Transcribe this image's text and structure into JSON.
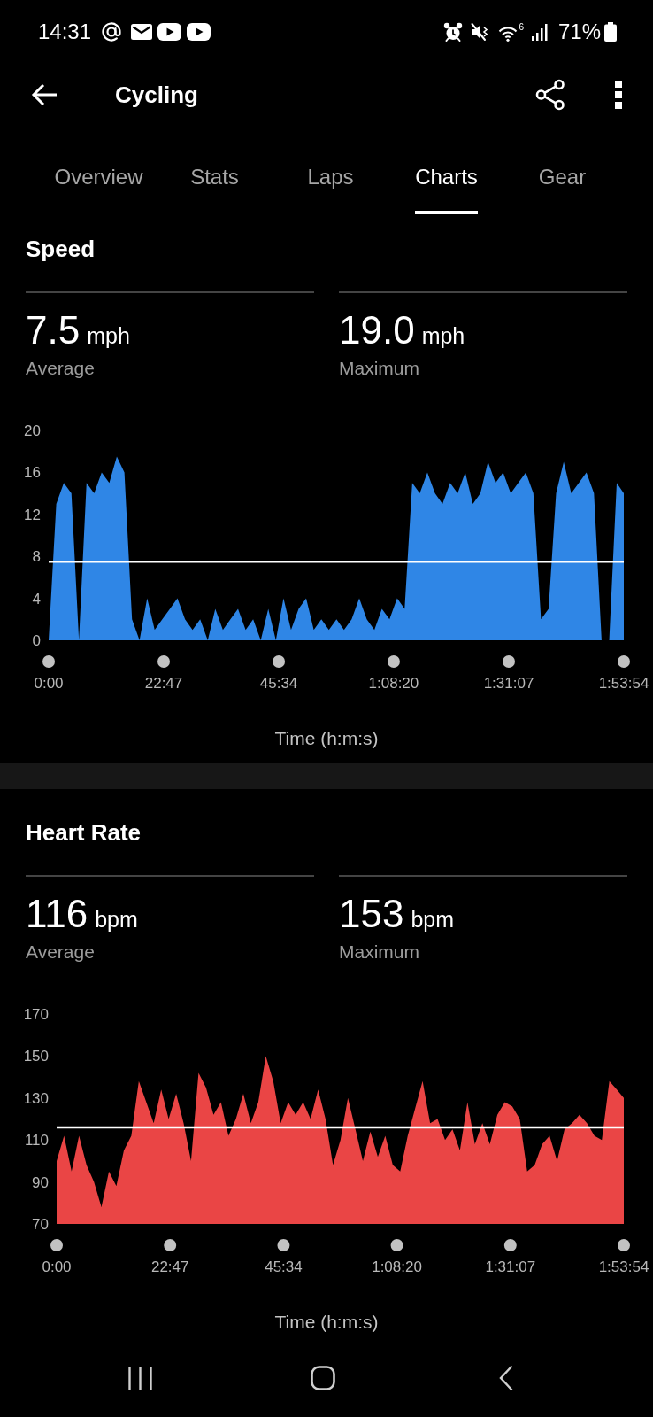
{
  "status_bar": {
    "time": "14:31",
    "wifi_badge": "6",
    "battery": "71%"
  },
  "header": {
    "title": "Cycling"
  },
  "tabs": [
    {
      "label": "Overview",
      "selected": false
    },
    {
      "label": "Stats",
      "selected": false
    },
    {
      "label": "Laps",
      "selected": false
    },
    {
      "label": "Charts",
      "selected": true
    },
    {
      "label": "Gear",
      "selected": false
    }
  ],
  "sections": [
    {
      "title": "Speed",
      "stats": [
        {
          "value": "7.5",
          "unit": "mph",
          "label": "Average"
        },
        {
          "value": "19.0",
          "unit": "mph",
          "label": "Maximum"
        }
      ],
      "chart_data": {
        "type": "area",
        "xlabel": "Time (h:m:s)",
        "x": [
          0,
          1.5,
          3,
          4.5,
          6,
          7.5,
          9,
          10.5,
          12,
          13.5,
          15,
          16.5,
          18,
          19.5,
          21,
          22.5,
          24,
          25.5,
          27,
          28.5,
          30,
          31.5,
          33,
          34.5,
          36,
          37.5,
          39,
          40.5,
          42,
          43.5,
          45,
          46.5,
          48,
          49.5,
          51,
          52.5,
          54,
          55.5,
          57,
          58.5,
          60,
          61.5,
          63,
          64.5,
          66,
          67.5,
          69,
          70.5,
          72,
          73.5,
          75,
          76.5,
          78,
          79.5,
          81,
          82.5,
          84,
          85.5,
          87,
          88.5,
          90,
          91.5,
          93,
          94.5,
          96,
          97.5,
          99,
          100.5,
          102,
          103.5,
          105,
          106.5,
          108,
          109.5,
          111,
          112.5,
          113.9
        ],
        "series": [
          {
            "color": "#2f86e6",
            "values": [
              0,
              13,
              15,
              14,
              0,
              15,
              14,
              16,
              15,
              17.5,
              16,
              2,
              0,
              4,
              1,
              2,
              3,
              4,
              2,
              1,
              2,
              0,
              3,
              1,
              2,
              3,
              1,
              2,
              0,
              3,
              0,
              4,
              1,
              3,
              4,
              1,
              2,
              1,
              2,
              1,
              2,
              4,
              2,
              1,
              3,
              2,
              4,
              3,
              15,
              14,
              16,
              14,
              13,
              15,
              14,
              16,
              13,
              14,
              17,
              15,
              16,
              14,
              15,
              16,
              14,
              2,
              3,
              14,
              17,
              14,
              15,
              16,
              14,
              0,
              0,
              15,
              14
            ]
          }
        ],
        "xlim": [
          0,
          113.9
        ],
        "ylim": [
          0,
          20
        ],
        "xticks": [
          {
            "value": 0,
            "label": "0:00"
          },
          {
            "value": 22.78,
            "label": "22:47"
          },
          {
            "value": 45.57,
            "label": "45:34"
          },
          {
            "value": 68.33,
            "label": "1:08:20"
          },
          {
            "value": 91.12,
            "label": "1:31:07"
          },
          {
            "value": 113.9,
            "label": "1:53:54"
          }
        ],
        "yticks": [
          0,
          4,
          8,
          12,
          16,
          20
        ],
        "ref_lines": [
          {
            "axis": "y",
            "value": 7.5
          }
        ]
      }
    },
    {
      "title": "Heart Rate",
      "stats": [
        {
          "value": "116",
          "unit": "bpm",
          "label": "Average"
        },
        {
          "value": "153",
          "unit": "bpm",
          "label": "Maximum"
        }
      ],
      "chart_data": {
        "type": "area",
        "xlabel": "Time (h:m:s)",
        "x": [
          0,
          1.5,
          3,
          4.5,
          6,
          7.5,
          9,
          10.5,
          12,
          13.5,
          15,
          16.5,
          18,
          19.5,
          21,
          22.5,
          24,
          25.5,
          27,
          28.5,
          30,
          31.5,
          33,
          34.5,
          36,
          37.5,
          39,
          40.5,
          42,
          43.5,
          45,
          46.5,
          48,
          49.5,
          51,
          52.5,
          54,
          55.5,
          57,
          58.5,
          60,
          61.5,
          63,
          64.5,
          66,
          67.5,
          69,
          70.5,
          72,
          73.5,
          75,
          76.5,
          78,
          79.5,
          81,
          82.5,
          84,
          85.5,
          87,
          88.5,
          90,
          91.5,
          93,
          94.5,
          96,
          97.5,
          99,
          100.5,
          102,
          103.5,
          105,
          106.5,
          108,
          109.5,
          111,
          112.5,
          113.9
        ],
        "series": [
          {
            "color": "#ea4545",
            "values": [
              100,
              112,
              95,
              112,
              98,
              90,
              78,
              95,
              88,
              105,
              112,
              138,
              128,
              118,
              134,
              120,
              132,
              118,
              100,
              142,
              135,
              122,
              128,
              112,
              120,
              132,
              118,
              128,
              150,
              138,
              118,
              128,
              122,
              128,
              120,
              134,
              120,
              98,
              110,
              130,
              115,
              100,
              114,
              102,
              112,
              98,
              95,
              112,
              125,
              138,
              118,
              120,
              110,
              115,
              105,
              128,
              108,
              118,
              108,
              122,
              128,
              126,
              120,
              95,
              98,
              108,
              112,
              100,
              115,
              118,
              122,
              118,
              112,
              110,
              138,
              134,
              130
            ]
          }
        ],
        "xlim": [
          0,
          113.9
        ],
        "ylim": [
          70,
          170
        ],
        "xticks": [
          {
            "value": 0,
            "label": "0:00"
          },
          {
            "value": 22.78,
            "label": "22:47"
          },
          {
            "value": 45.57,
            "label": "45:34"
          },
          {
            "value": 68.33,
            "label": "1:08:20"
          },
          {
            "value": 91.12,
            "label": "1:31:07"
          },
          {
            "value": 113.9,
            "label": "1:53:54"
          }
        ],
        "yticks": [
          70,
          90,
          110,
          130,
          150,
          170
        ],
        "ref_lines": [
          {
            "axis": "y",
            "value": 116
          }
        ]
      }
    }
  ]
}
